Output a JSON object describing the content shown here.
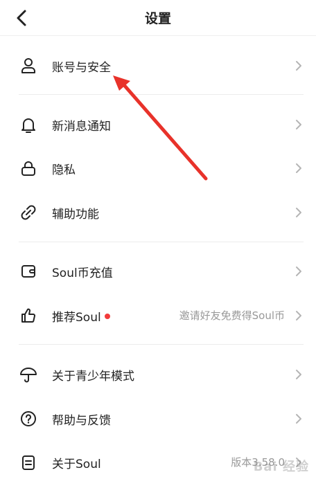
{
  "header": {
    "title": "设置"
  },
  "rows": [
    {
      "label": "账号与安全"
    },
    {
      "label": "新消息通知"
    },
    {
      "label": "隐私"
    },
    {
      "label": "辅助功能"
    },
    {
      "label": "Soul币充值"
    },
    {
      "label": "推荐Soul",
      "right": "邀请好友免费得Soul币"
    },
    {
      "label": "关于青少年模式"
    },
    {
      "label": "帮助与反馈"
    },
    {
      "label": "关于Soul",
      "right": "版本3.58.0"
    }
  ],
  "watermark": "Bai 经验",
  "colors": {
    "accent_red": "#f23b3b",
    "annotation_arrow": "#e8322a"
  },
  "icons": [
    "back-chevron-icon",
    "user-icon",
    "bell-icon",
    "lock-icon",
    "link-icon",
    "wallet-icon",
    "thumbs-up-icon",
    "umbrella-icon",
    "help-icon",
    "document-icon",
    "chevron-right-icon"
  ]
}
